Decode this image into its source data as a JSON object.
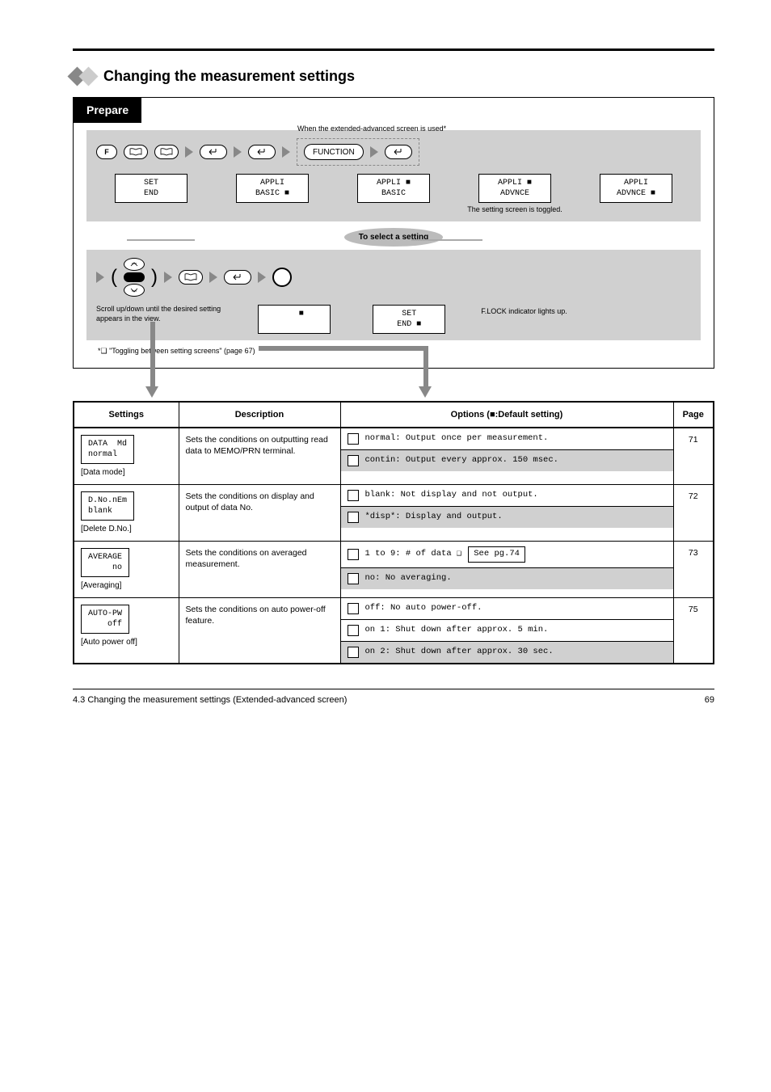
{
  "section_title": "Changing the measurement settings",
  "panel_tab": "Prepare",
  "dashed_note": "When the extended-advanced screen is used*",
  "flow1": {
    "btn_f": "F",
    "btn_long": "FUNCTION",
    "cells": [
      {
        "display": "SET\nEND",
        "caption": ""
      },
      {
        "display": "APPLI\nBASIC ■",
        "caption": ""
      },
      {
        "display": "APPLI ■\nBASIC",
        "caption": ""
      },
      {
        "display": "APPLI ■\nADVNCE",
        "caption": "The setting screen is toggled."
      },
      {
        "display": "APPLI\nADVNCE ■",
        "caption": ""
      }
    ]
  },
  "asterisk_note": "*❑ \"Toggling between setting screens\" (page 67)",
  "oval_text": "To select a setting",
  "flow2": {
    "scroll_hint": "Scroll up/down until the desired setting appears in the view.",
    "cells": [
      {
        "display": "   ■\n ",
        "caption": ""
      },
      {
        "display": "SET\nEND ■",
        "caption": ""
      }
    ],
    "dial_caption": "F.LOCK indicator\nlights up."
  },
  "table": {
    "headers": [
      "Settings",
      "Description",
      "Options (■:Default setting)",
      "Page"
    ],
    "rows": [
      {
        "settings_box": "DATA  Md\nnormal",
        "settings_label": "[Data mode]",
        "description": "Sets the conditions on outputting read data to MEMO/PRN terminal.",
        "options": [
          {
            "label": "normal: Output once per measurement.",
            "shaded": false
          },
          {
            "label": "contin: Output every approx. 150 msec.",
            "shaded": true
          }
        ],
        "page": "71"
      },
      {
        "settings_box": "D.No.nEm\nblank",
        "settings_label": "[Delete D.No.]",
        "description": "Sets the conditions on display and output of data No.",
        "options": [
          {
            "label": "blank: Not display and not output.",
            "shaded": false
          },
          {
            "label": "*disp*: Display and output.",
            "shaded": true
          }
        ],
        "page": "72"
      },
      {
        "settings_box": "AVERAGE\n     no",
        "settings_label": "[Averaging]",
        "description": "Sets the conditions on averaged measurement.",
        "options": [
          {
            "label": "1 to 9: # of data ❑ ",
            "see": "See pg.74",
            "shaded": false
          },
          {
            "label": "no:     No averaging.",
            "shaded": true
          }
        ],
        "page": "73"
      },
      {
        "settings_box": "AUTO-PW\n    off",
        "settings_label": "[Auto power off]",
        "description": "Sets the conditions on auto power-off feature.",
        "options": [
          {
            "label": "off:   No auto power-off.",
            "shaded": false
          },
          {
            "label": "on  1: Shut down after approx. 5 min.",
            "shaded": false
          },
          {
            "label": "on  2: Shut down after approx. 30 sec.",
            "shaded": true
          }
        ],
        "page": "75"
      }
    ]
  },
  "footer_left": "4.3 Changing the measurement settings (Extended-advanced screen)",
  "footer_right": "69"
}
